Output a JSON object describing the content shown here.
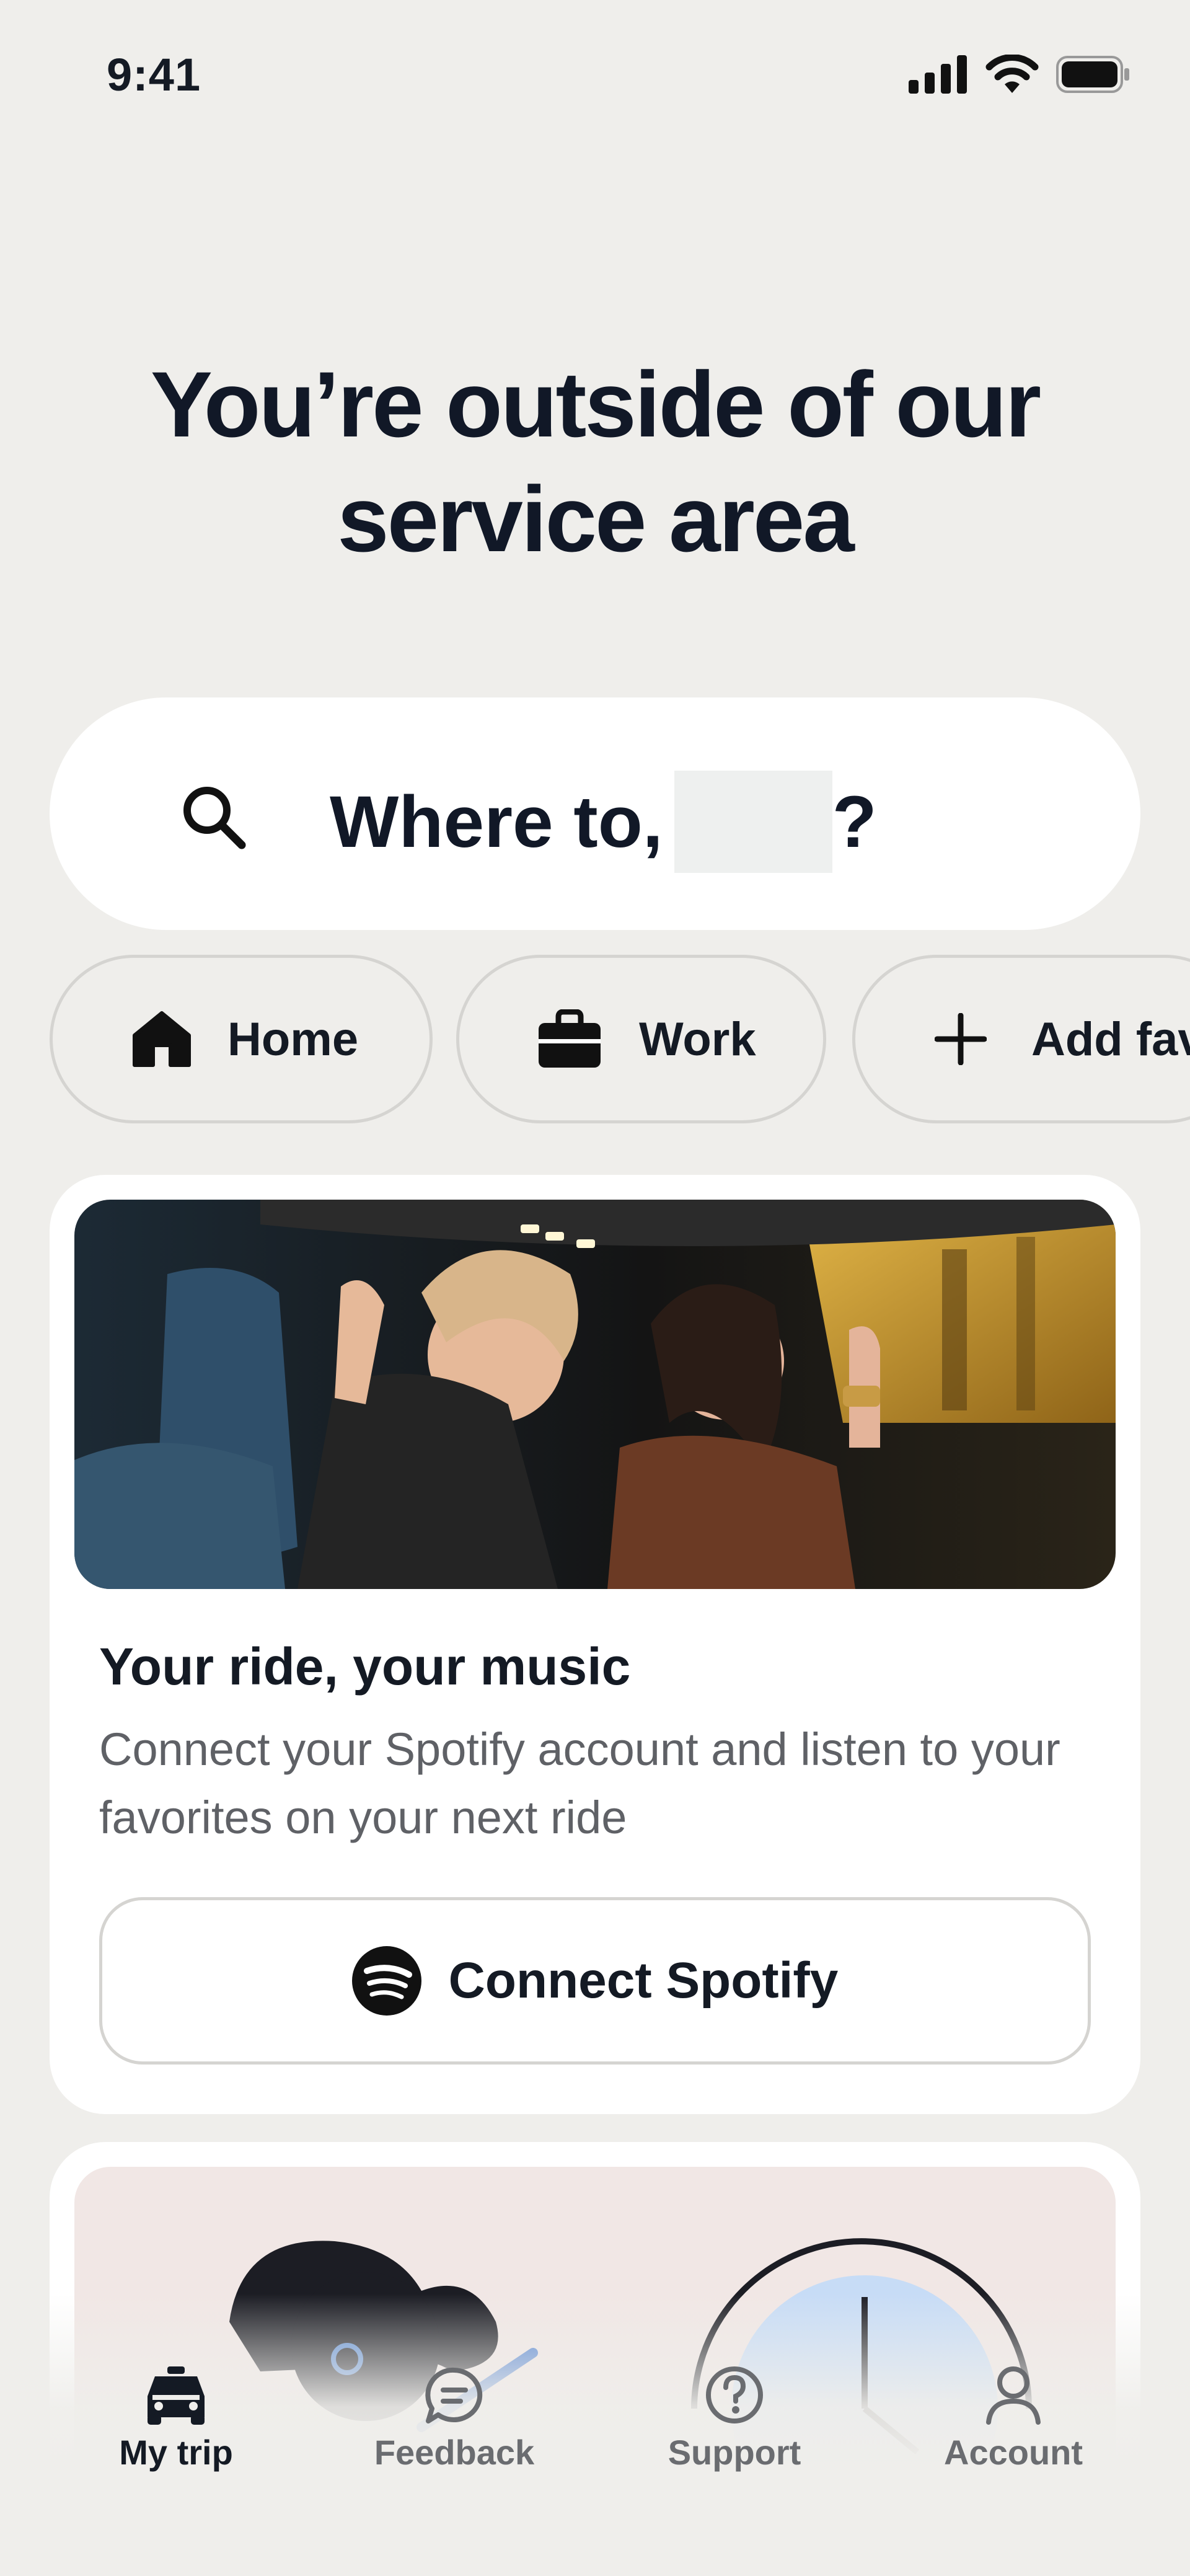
{
  "status_bar": {
    "time": "9:41"
  },
  "headline": {
    "line1": "You’re outside of our",
    "line2": "service area"
  },
  "search": {
    "prompt": "Where to,",
    "suffix": "?"
  },
  "chips": [
    {
      "label": "Home",
      "icon": "home-icon"
    },
    {
      "label": "Work",
      "icon": "briefcase-icon"
    },
    {
      "label": "Add fav",
      "icon": "plus-icon"
    }
  ],
  "spotify_card": {
    "title": "Your ride, your music",
    "description": "Connect your Spotify account and listen to your favorites on your next ride",
    "button_label": "Connect Spotify",
    "button_icon": "spotify-icon"
  },
  "tabs": [
    {
      "label": "My trip",
      "icon": "car-icon",
      "active": true
    },
    {
      "label": "Feedback",
      "icon": "chat-bubble-icon",
      "active": false
    },
    {
      "label": "Support",
      "icon": "question-icon",
      "active": false
    },
    {
      "label": "Account",
      "icon": "person-icon",
      "active": false
    }
  ],
  "colors": {
    "background": "#efeeeb",
    "text": "#141a24",
    "muted": "#5f6166",
    "card": "#ffffff"
  }
}
